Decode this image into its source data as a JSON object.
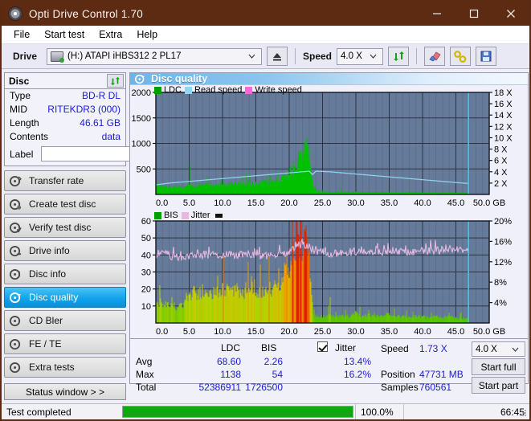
{
  "window": {
    "title": "Opti Drive Control 1.70",
    "app_icon": "disc-icon",
    "minimize": "–",
    "maximize": "□",
    "close": "✕"
  },
  "menu": {
    "items": [
      {
        "label": "File"
      },
      {
        "label": "Start test"
      },
      {
        "label": "Extra"
      },
      {
        "label": "Help"
      }
    ]
  },
  "toolbar": {
    "drive_label": "Drive",
    "drive_value": "(H:)  ATAPI iHBS312  2 PL17",
    "eject_icon": "eject-icon",
    "speed_label": "Speed",
    "speed_value": "4.0 X",
    "refresh_icon": "refresh-icon",
    "erase_icon": "eraser-icon",
    "tools_icon": "wrench-icon",
    "save_icon": "floppy-save-icon"
  },
  "disc_panel": {
    "title": "Disc",
    "refresh_icon": "refresh-icon",
    "rows": [
      {
        "key": "Type",
        "value": "BD-R DL"
      },
      {
        "key": "MID",
        "value": "RITEKDR3 (000)"
      },
      {
        "key": "Length",
        "value": "46.61 GB"
      },
      {
        "key": "Contents",
        "value": "data"
      }
    ],
    "label_key": "Label",
    "label_value": "",
    "label_placeholder": "",
    "disc_button_icon": "cd-disc-icon"
  },
  "sidebar": {
    "items": [
      {
        "label": "Transfer rate",
        "icon": "disc-transfer-icon",
        "selected": false
      },
      {
        "label": "Create test disc",
        "icon": "disc-create-icon",
        "selected": false
      },
      {
        "label": "Verify test disc",
        "icon": "disc-verify-icon",
        "selected": false
      },
      {
        "label": "Drive info",
        "icon": "drive-info-icon",
        "selected": false
      },
      {
        "label": "Disc info",
        "icon": "disc-info-icon",
        "selected": false
      },
      {
        "label": "Disc quality",
        "icon": "disc-quality-icon",
        "selected": true
      },
      {
        "label": "CD Bler",
        "icon": "cd-bler-icon",
        "selected": false
      },
      {
        "label": "FE / TE",
        "icon": "fe-te-icon",
        "selected": false
      },
      {
        "label": "Extra tests",
        "icon": "extra-tests-icon",
        "selected": false
      }
    ],
    "status_window_button": "Status window > >"
  },
  "content": {
    "title": "Disc quality",
    "title_icon": "disc-quality-icon"
  },
  "results": {
    "col_ldc": "LDC",
    "col_bis": "BIS",
    "jitter_label": "Jitter",
    "jitter_checked": true,
    "rows": [
      {
        "label": "Avg",
        "ldc": "68.60",
        "bis": "2.26",
        "jitter": "13.4%"
      },
      {
        "label": "Max",
        "ldc": "1138",
        "bis": "54",
        "jitter": "16.2%"
      },
      {
        "label": "Total",
        "ldc": "52386911",
        "bis": "1726500",
        "jitter": ""
      }
    ],
    "speed_label": "Speed",
    "speed_value": "1.73 X",
    "position_label": "Position",
    "position_value": "47731 MB",
    "samples_label": "Samples",
    "samples_value": "760561",
    "speed_select": "4.0 X",
    "start_full_button": "Start full",
    "start_part_button": "Start part"
  },
  "statusbar": {
    "text": "Test completed",
    "progress_percent": "100.0%",
    "progress_value": 100,
    "elapsed": "66:45"
  },
  "colors": {
    "title_bar": "#5d2a12",
    "ldc_green": "#00c000",
    "read_speed_blue": "#8fd8f5",
    "write_speed_pink": "#ff66d9",
    "bis_green": "#00a000",
    "jitter_pink": "#e5b8e0",
    "plot_bg": "#667a9a",
    "selection_blue": "#12a3ec",
    "progress_green": "#0fa80f"
  },
  "chart_data": [
    {
      "id": "chart-top",
      "type": "area",
      "title": "",
      "xlabel": "GB",
      "ylabel": "LDC",
      "y2label": "X",
      "xlim": [
        0.0,
        50.0
      ],
      "ylim": [
        0,
        2000
      ],
      "y2lim": [
        0,
        18
      ],
      "xticks": [
        0.0,
        5.0,
        10.0,
        15.0,
        20.0,
        25.0,
        30.0,
        35.0,
        40.0,
        45.0,
        50.0
      ],
      "xticklabels": [
        "0.0",
        "5.0",
        "10.0",
        "15.0",
        "20.0",
        "25.0",
        "30.0",
        "35.0",
        "40.0",
        "45.0",
        "50.0 GB"
      ],
      "yticks": [
        500,
        1000,
        1500,
        2000
      ],
      "yticklabels": [
        "500",
        "1000",
        "1500",
        "2000"
      ],
      "y2ticks": [
        2,
        4,
        6,
        8,
        10,
        12,
        14,
        16,
        18
      ],
      "y2ticklabels": [
        "2 X",
        "4 X",
        "6 X",
        "8 X",
        "10 X",
        "12 X",
        "14 X",
        "16 X",
        "18 X"
      ],
      "grid": true,
      "legend": [
        {
          "name": "LDC",
          "color": "#00a000"
        },
        {
          "name": "Read speed",
          "color": "#8fd8f5"
        },
        {
          "name": "Write speed",
          "color": "#ff66d9"
        }
      ],
      "legend_position": "top-left",
      "series": [
        {
          "name": "LDC",
          "type": "area",
          "color": "#00c000",
          "x": [
            0.0,
            0.5,
            1.0,
            1.5,
            2.0,
            2.5,
            3.0,
            3.5,
            4.0,
            4.5,
            5.0,
            5.5,
            6.0,
            6.5,
            7.0,
            7.5,
            8.0,
            8.5,
            9.0,
            9.5,
            10.0,
            10.5,
            11.0,
            11.5,
            12.0,
            12.5,
            13.0,
            13.5,
            14.0,
            14.5,
            15.0,
            15.5,
            16.0,
            16.5,
            17.0,
            17.5,
            18.0,
            18.5,
            19.0,
            19.5,
            20.0,
            20.5,
            21.0,
            21.5,
            22.0,
            22.5,
            23.0,
            23.3,
            23.6,
            24.0,
            25.0,
            26.0,
            27.0,
            28.0,
            29.0,
            30.0,
            31.0,
            32.0,
            33.0,
            34.0,
            35.0,
            36.0,
            37.0,
            38.0,
            39.0,
            40.0,
            41.0,
            42.0,
            43.0,
            44.0,
            45.0,
            46.0,
            46.8
          ],
          "y": [
            190,
            215,
            180,
            165,
            150,
            150,
            150,
            145,
            150,
            170,
            175,
            170,
            175,
            180,
            185,
            180,
            185,
            190,
            195,
            195,
            200,
            195,
            200,
            205,
            210,
            215,
            220,
            215,
            220,
            225,
            230,
            235,
            240,
            250,
            255,
            260,
            275,
            300,
            330,
            380,
            430,
            520,
            640,
            790,
            900,
            1000,
            820,
            520,
            150,
            60,
            55,
            50,
            45,
            50,
            45,
            45,
            42,
            45,
            40,
            42,
            40,
            38,
            38,
            36,
            35,
            35,
            34,
            33,
            32,
            32,
            30,
            30,
            28
          ]
        },
        {
          "name": "Read speed",
          "type": "line",
          "color": "#8fd8f5",
          "axis": "y2",
          "x": [
            0.0,
            2.0,
            4.0,
            6.0,
            8.0,
            10.0,
            12.0,
            14.0,
            16.0,
            18.0,
            20.0,
            22.0,
            23.0,
            23.5,
            24.0,
            26.0,
            28.0,
            30.0,
            32.0,
            34.0,
            36.0,
            38.0,
            40.0,
            42.0,
            44.0,
            46.0,
            46.8
          ],
          "y": [
            1.7,
            2.0,
            2.2,
            2.4,
            2.6,
            2.8,
            3.0,
            3.2,
            3.4,
            3.6,
            3.8,
            4.0,
            4.1,
            3.5,
            4.1,
            4.0,
            3.8,
            3.6,
            3.4,
            3.2,
            3.0,
            2.8,
            2.6,
            2.4,
            2.2,
            2.0,
            1.95
          ]
        },
        {
          "name": "Write speed",
          "type": "line",
          "color": "#ff66d9",
          "axis": "y2",
          "x": [],
          "y": []
        }
      ],
      "markers": [
        {
          "name": "position-cursor",
          "x": 46.9,
          "color": "#22d3f5"
        }
      ]
    },
    {
      "id": "chart-bottom",
      "type": "area",
      "title": "",
      "xlabel": "GB",
      "ylabel": "BIS",
      "y2label": "%",
      "xlim": [
        0.0,
        50.0
      ],
      "ylim": [
        0,
        60
      ],
      "y2lim": [
        0,
        20
      ],
      "xticks": [
        0.0,
        5.0,
        10.0,
        15.0,
        20.0,
        25.0,
        30.0,
        35.0,
        40.0,
        45.0,
        50.0
      ],
      "xticklabels": [
        "0.0",
        "5.0",
        "10.0",
        "15.0",
        "20.0",
        "25.0",
        "30.0",
        "35.0",
        "40.0",
        "45.0",
        "50.0 GB"
      ],
      "yticks": [
        10,
        20,
        30,
        40,
        50,
        60
      ],
      "yticklabels": [
        "10",
        "20",
        "30",
        "40",
        "50",
        "60"
      ],
      "y2ticks": [
        4,
        8,
        12,
        16,
        20
      ],
      "y2ticklabels": [
        "4%",
        "8%",
        "12%",
        "16%",
        "20%"
      ],
      "grid": true,
      "legend": [
        {
          "name": "BIS",
          "color": "#00a000"
        },
        {
          "name": "Jitter",
          "color": "#e5b8e0"
        }
      ],
      "legend_position": "top-left",
      "series": [
        {
          "name": "BIS",
          "type": "area",
          "color_scale": [
            "#3ec000",
            "#b8d400",
            "#f0a000",
            "#e02000"
          ],
          "x": [
            0.0,
            0.5,
            1.0,
            1.5,
            2.0,
            2.5,
            3.0,
            3.5,
            4.0,
            4.5,
            5.0,
            5.5,
            6.0,
            6.5,
            7.0,
            7.5,
            8.0,
            8.5,
            9.0,
            9.5,
            10.0,
            10.5,
            11.0,
            11.5,
            12.0,
            12.5,
            13.0,
            13.5,
            14.0,
            14.5,
            15.0,
            15.5,
            16.0,
            16.5,
            17.0,
            17.5,
            18.0,
            18.5,
            19.0,
            19.5,
            20.0,
            20.5,
            21.0,
            21.5,
            22.0,
            22.5,
            23.0,
            23.3,
            23.6,
            24.0,
            25.0,
            26.0,
            27.0,
            28.0,
            29.0,
            30.0,
            31.0,
            32.0,
            33.0,
            34.0,
            35.0,
            36.0,
            37.0,
            38.0,
            39.0,
            40.0,
            41.0,
            42.0,
            43.0,
            44.0,
            45.0,
            46.0,
            46.8
          ],
          "y": [
            14,
            13,
            12,
            11,
            11,
            10,
            10,
            11,
            11,
            14,
            17,
            18,
            18,
            19,
            19,
            19,
            20,
            19,
            20,
            19,
            20,
            19,
            20,
            19,
            19,
            20,
            19,
            20,
            19,
            20,
            19,
            19,
            19,
            20,
            20,
            21,
            22,
            24,
            27,
            31,
            36,
            42,
            48,
            52,
            50,
            48,
            42,
            22,
            5,
            4,
            4,
            5,
            4,
            5,
            4,
            6,
            4,
            5,
            4,
            5,
            5,
            4,
            4,
            4,
            4,
            4,
            3,
            4,
            3,
            4,
            3,
            3,
            3
          ]
        },
        {
          "name": "Jitter",
          "type": "line",
          "color": "#e5b8e0",
          "axis": "y2",
          "x": [
            0.0,
            0.5,
            1.0,
            1.5,
            2.0,
            2.5,
            3.0,
            3.5,
            4.0,
            5.0,
            6.0,
            7.0,
            8.0,
            9.0,
            10.0,
            11.0,
            12.0,
            13.0,
            14.0,
            15.0,
            16.0,
            17.0,
            18.0,
            19.0,
            20.0,
            20.5,
            21.0,
            21.5,
            22.0,
            22.5,
            23.0,
            23.5,
            24.0,
            25.0,
            26.0,
            27.0,
            28.0,
            29.0,
            30.0,
            31.0,
            32.0,
            33.0,
            34.0,
            35.0,
            36.0,
            37.0,
            38.0,
            39.0,
            40.0,
            41.0,
            42.0,
            43.0,
            44.0,
            45.0,
            46.0,
            46.8
          ],
          "y": [
            13.0,
            13.8,
            14.1,
            13.6,
            13.2,
            13.0,
            12.8,
            12.7,
            12.8,
            13.1,
            13.2,
            13.3,
            13.3,
            13.3,
            13.3,
            13.3,
            13.2,
            13.3,
            13.2,
            13.1,
            13.1,
            13.2,
            13.3,
            13.5,
            13.8,
            14.2,
            14.8,
            15.2,
            15.4,
            15.1,
            14.8,
            14.3,
            14.0,
            13.8,
            13.6,
            13.6,
            13.7,
            13.8,
            13.9,
            13.8,
            13.9,
            14.0,
            13.9,
            14.0,
            13.9,
            14.0,
            13.9,
            14.0,
            14.1,
            14.0,
            14.1,
            14.0,
            14.1,
            14.2,
            14.1,
            14.0
          ]
        }
      ],
      "markers": [
        {
          "name": "position-cursor",
          "x": 46.9,
          "color": "#22d3f5"
        }
      ]
    }
  ]
}
